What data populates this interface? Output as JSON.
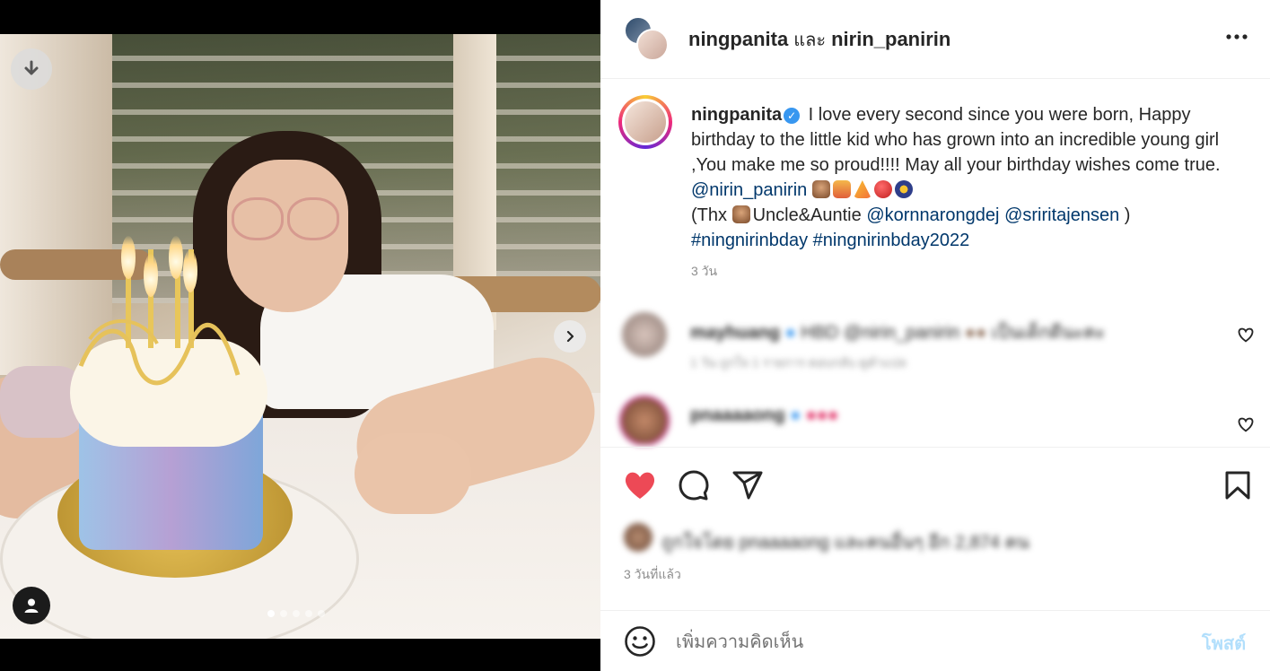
{
  "header": {
    "author": "ningpanita",
    "conjunction": "และ",
    "coauthor": "nirin_panirin"
  },
  "caption": {
    "username": "ningpanita",
    "text_main": "I love every second since you were born, Happy birthday to the little kid who has grown into an incredible young girl ,You make me so proud!!!! May all your birthday wishes come true.",
    "mention1": "@nirin_panirin",
    "thx_prefix": "(Thx",
    "thx_names": "Uncle&Auntie",
    "mention2": "@kornnarongdej",
    "mention3": "@sriritajensen",
    "thx_suffix": ")",
    "hashtag1": "#ningnirinbday",
    "hashtag2": "#ningnirinbday2022",
    "time": "3 วัน"
  },
  "comments": [
    {
      "username": "mayhuang",
      "text": "HBD @nirin_panirin",
      "extra": "เป็นเด็กดีนะคะ",
      "meta": "1 วัน   ถูกใจ 1 รายการ   ตอบกลับ   ดูคำแปล"
    },
    {
      "username": "pnaaaaong",
      "text": ""
    }
  ],
  "likes": {
    "text": "ถูกใจโดย pnaaaaong และคนอื่นๆ อีก 2,874 คน"
  },
  "post_time": "3 วันที่แล้ว",
  "composer": {
    "placeholder": "เพิ่มความคิดเห็น",
    "post_label": "โพสต์"
  },
  "carousel": {
    "total": 5,
    "active_index": 0
  },
  "colors": {
    "like_red": "#ed4956",
    "link_blue": "#00376b",
    "verified_blue": "#3897f0",
    "post_button_disabled": "#b2dffc"
  },
  "icons": [
    "download-icon",
    "chevron-right-icon",
    "user-tag-icon",
    "more-options-icon",
    "verified-badge-icon",
    "heart-icon",
    "comment-icon",
    "share-icon",
    "bookmark-icon",
    "emoji-icon"
  ]
}
